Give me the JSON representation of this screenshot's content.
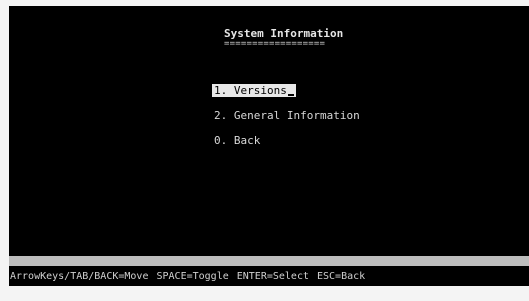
{
  "screen": {
    "title": "System Information",
    "title_underline": "=================="
  },
  "menu": {
    "items": [
      {
        "label": "1. Versions",
        "selected": true
      },
      {
        "label": "2. General Information",
        "selected": false
      },
      {
        "label": "0. Back",
        "selected": false
      }
    ]
  },
  "help": {
    "move": "ArrowKeys/TAB/BACK=Move",
    "toggle": "SPACE=Toggle",
    "select": "ENTER=Select",
    "back": "ESC=Back"
  },
  "colors": {
    "background": "#000000",
    "text": "#d8d8d8",
    "highlight": "#e8e8e8",
    "statusbar": "#bdbdbd"
  }
}
